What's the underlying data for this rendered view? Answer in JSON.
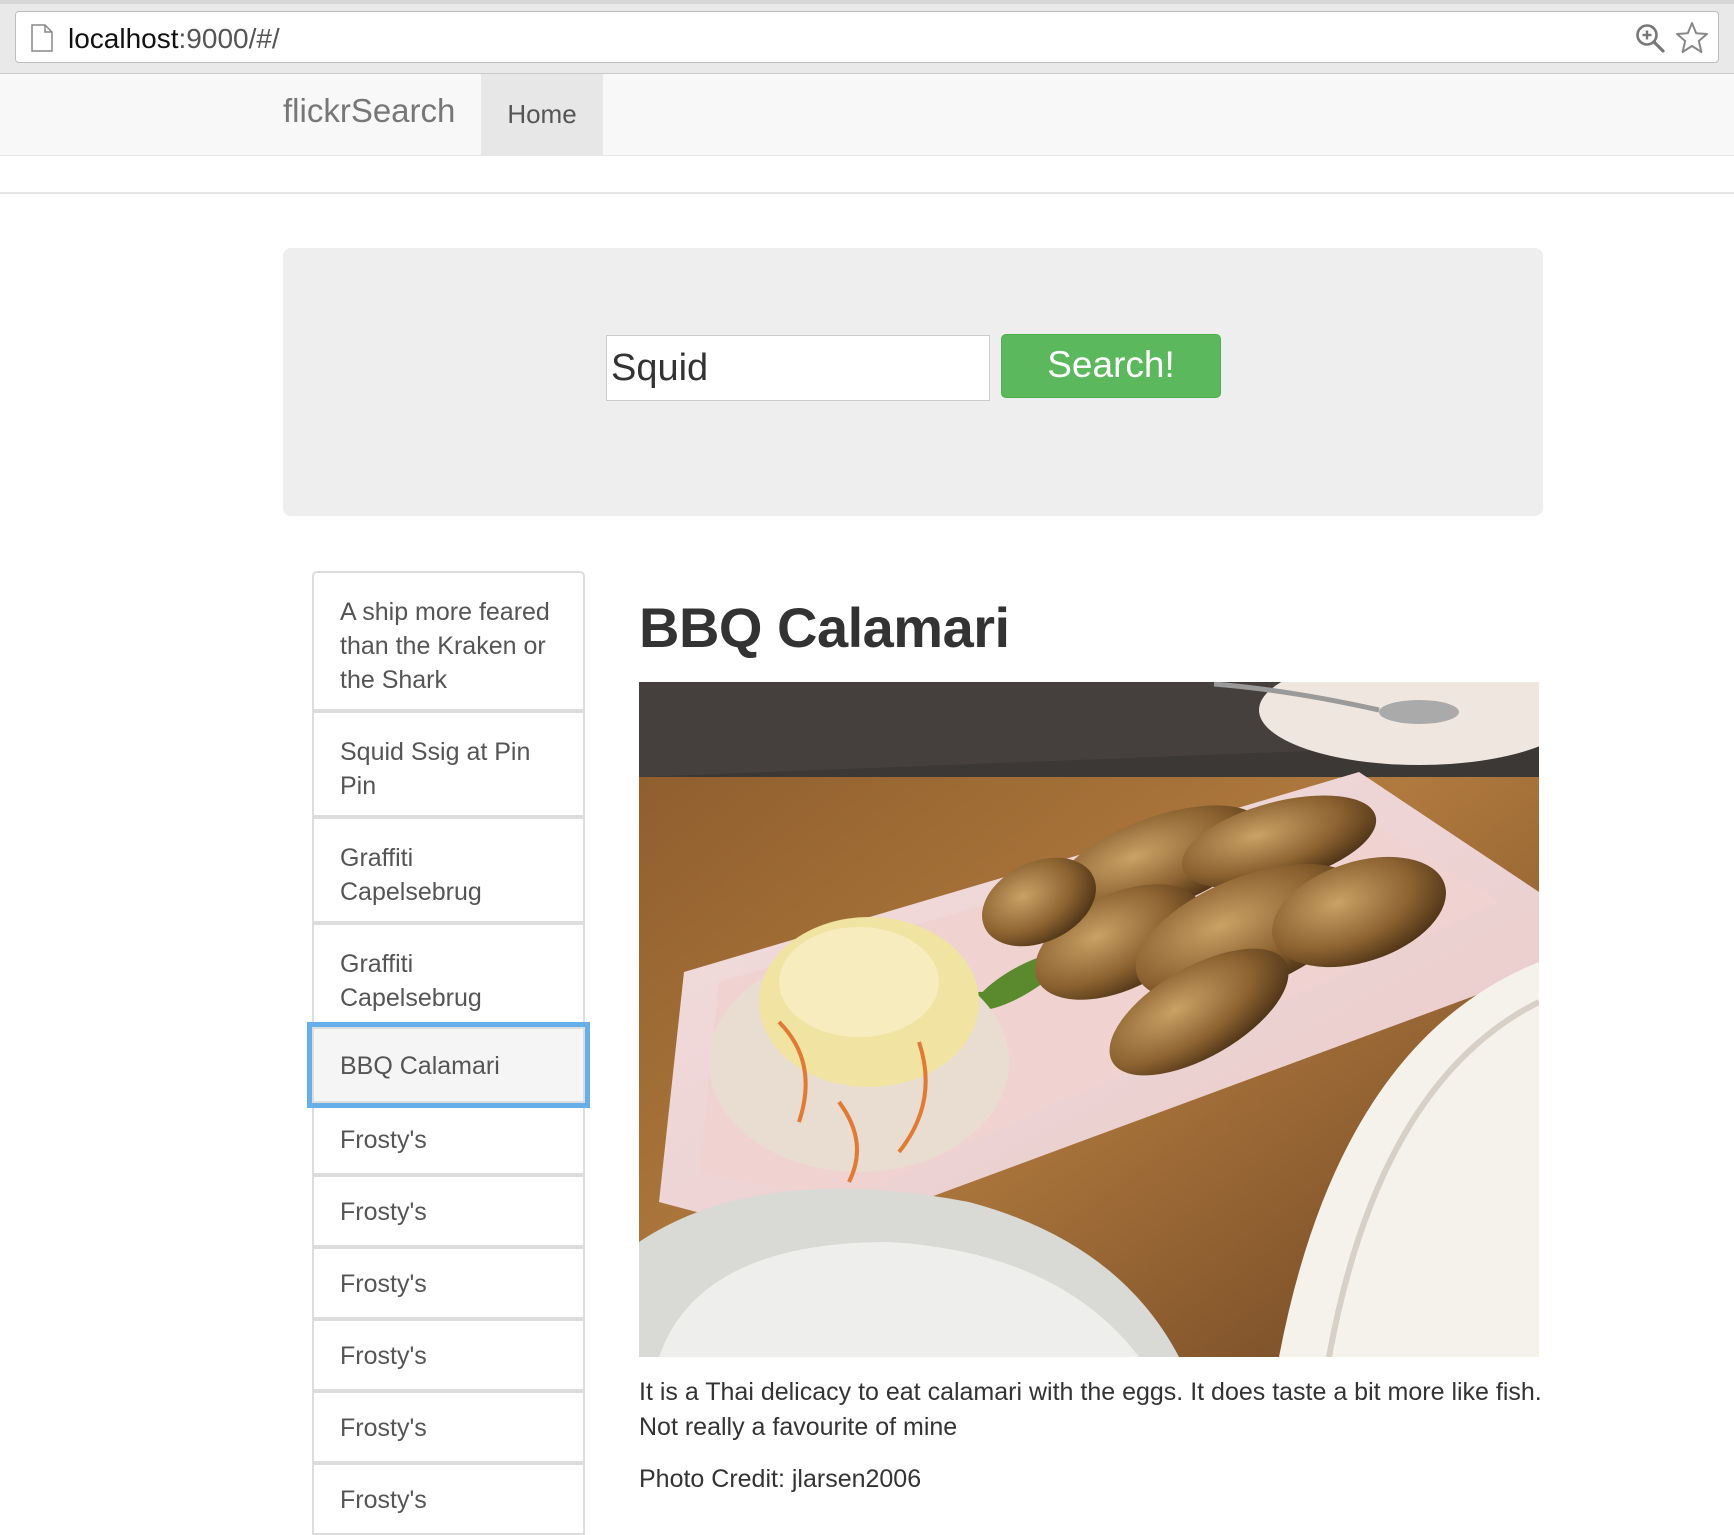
{
  "browser": {
    "url_host": "localhost",
    "url_rest": ":9000/#/"
  },
  "navbar": {
    "brand": "flickrSearch",
    "items": [
      {
        "label": "Home",
        "active": true
      }
    ]
  },
  "search": {
    "value": "Squid",
    "button_label": "Search!",
    "button_color": "#5cb85c"
  },
  "results": {
    "selected_index": 4,
    "items": [
      {
        "label": "A ship more feared than the Kraken or the Shark"
      },
      {
        "label": "Squid Ssig at Pin Pin"
      },
      {
        "label": "Graffiti Capelsebrug"
      },
      {
        "label": "Graffiti Capelsebrug"
      },
      {
        "label": "BBQ Calamari"
      },
      {
        "label": "Frosty's"
      },
      {
        "label": "Frosty's"
      },
      {
        "label": "Frosty's"
      },
      {
        "label": "Frosty's"
      },
      {
        "label": "Frosty's"
      },
      {
        "label": "Frosty's"
      }
    ]
  },
  "detail": {
    "title": "BBQ Calamari",
    "description": "It is a Thai delicacy to eat calamari with the eggs. It does taste a bit more like fish. Not really a favourite of mine",
    "credit": "Photo Credit: jlarsen2006"
  },
  "colors": {
    "selection_outline": "#66afe9",
    "navbar_bg": "#f8f8f8",
    "jumbotron_bg": "#eeeeee"
  }
}
